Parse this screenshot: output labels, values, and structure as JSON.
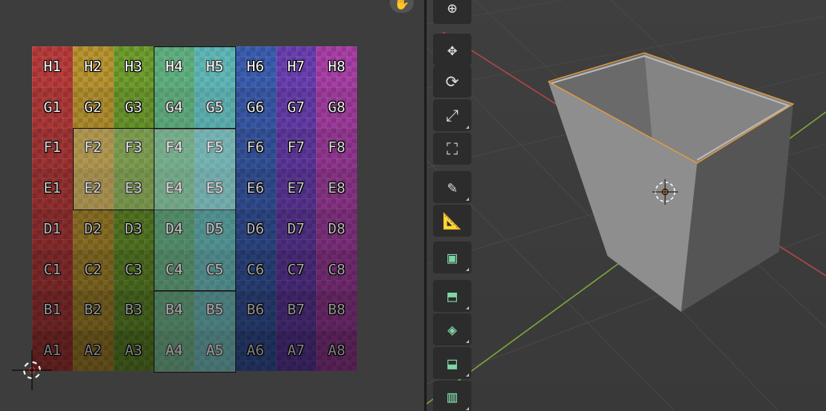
{
  "uv_grid": {
    "rows": [
      [
        "H1",
        "H2",
        "H3",
        "H4",
        "H5",
        "H6",
        "H7",
        "H8"
      ],
      [
        "G1",
        "G2",
        "G3",
        "G4",
        "G5",
        "G6",
        "G7",
        "G8"
      ],
      [
        "F1",
        "F2",
        "F3",
        "F4",
        "F5",
        "F6",
        "F7",
        "F8"
      ],
      [
        "E1",
        "E2",
        "E3",
        "E4",
        "E5",
        "E6",
        "E7",
        "E8"
      ],
      [
        "D1",
        "D2",
        "D3",
        "D4",
        "D5",
        "D6",
        "D7",
        "D8"
      ],
      [
        "C1",
        "C2",
        "C3",
        "C4",
        "C5",
        "C6",
        "C7",
        "C8"
      ],
      [
        "B1",
        "B2",
        "B3",
        "B4",
        "B5",
        "B6",
        "B7",
        "B8"
      ],
      [
        "A1",
        "A2",
        "A3",
        "A4",
        "A5",
        "A6",
        "A7",
        "A8"
      ]
    ],
    "column_colors": [
      "#b83a3a",
      "#b8942e",
      "#6e9d2c",
      "#3a9e62",
      "#39a8a8",
      "#3a5db0",
      "#6a3eb2",
      "#a83ea6"
    ]
  },
  "toolbar": {
    "tools": [
      {
        "name": "cursor-tool",
        "icon": "cursor-icon"
      },
      {
        "name": "move-tool",
        "icon": "move-icon"
      },
      {
        "name": "rotate-tool",
        "icon": "rotate-icon"
      },
      {
        "name": "scale-tool",
        "icon": "scale-icon"
      },
      {
        "name": "transform-tool",
        "icon": "transform-icon"
      },
      {
        "name": "annotate-tool",
        "icon": "annotate-icon"
      },
      {
        "name": "measure-tool",
        "icon": "measure-icon"
      },
      {
        "name": "add-cube-tool",
        "icon": "add-cube-icon"
      },
      {
        "name": "extrude-region-tool",
        "icon": "extrude-icon"
      },
      {
        "name": "inset-faces-tool",
        "icon": "inset-icon"
      },
      {
        "name": "bevel-tool",
        "icon": "bevel-icon"
      },
      {
        "name": "loop-cut-tool",
        "icon": "loop-cut-icon"
      }
    ]
  },
  "colors": {
    "viewport_bg": "#3d3d3d",
    "x_axis": "#c04a4a",
    "y_axis": "#7ea83a",
    "selection_outline": "#e89b3c",
    "tool_active": "#7fd4a4"
  }
}
